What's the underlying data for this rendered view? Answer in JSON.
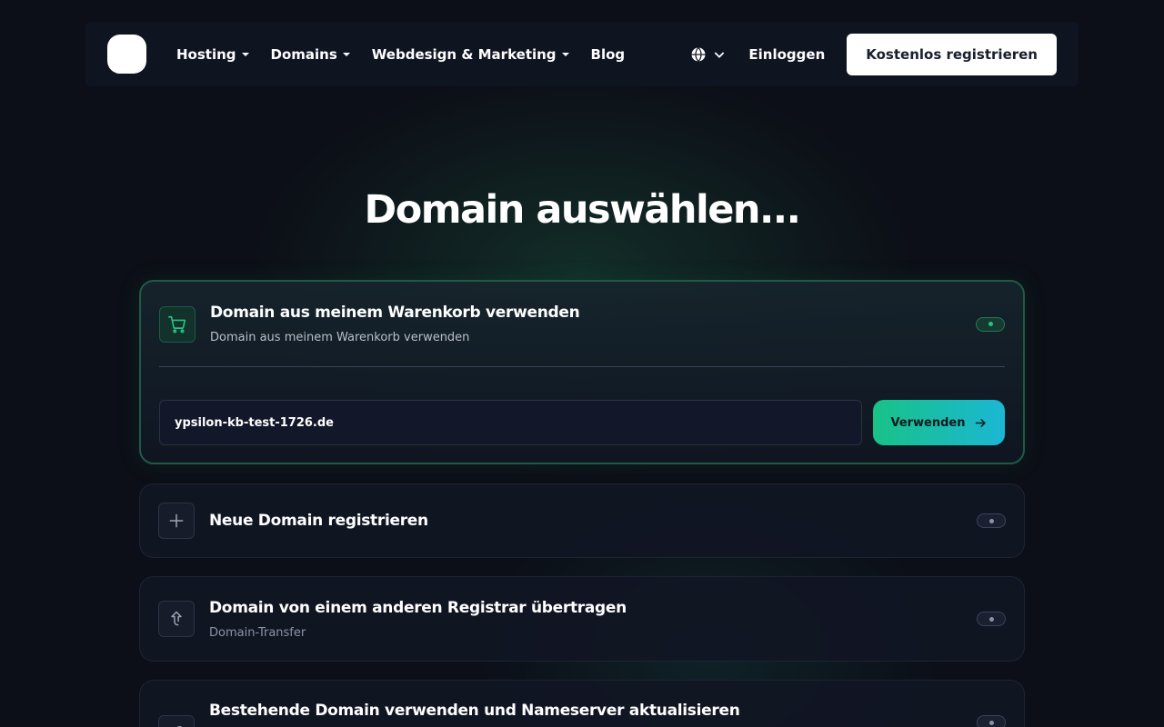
{
  "nav": {
    "items": [
      {
        "label": "Hosting",
        "dropdown": true
      },
      {
        "label": "Domains",
        "dropdown": true
      },
      {
        "label": "Webdesign & Marketing",
        "dropdown": true
      },
      {
        "label": "Blog",
        "dropdown": false
      }
    ],
    "language_icon": "globe-icon",
    "login_label": "Einloggen",
    "register_label": "Kostenlos registrieren"
  },
  "page": {
    "title": "Domain auswählen..."
  },
  "options": [
    {
      "title": "Domain aus meinem Warenkorb verwenden",
      "subtitle": "Domain aus meinem Warenkorb verwenden",
      "icon": "cart-icon",
      "selected": true,
      "input_value": "ypsilon-kb-test-1726.de",
      "button_label": "Verwenden"
    },
    {
      "title": "Neue Domain registrieren",
      "icon": "plus-icon",
      "selected": false
    },
    {
      "title": "Domain von einem anderen Registrar übertragen",
      "subtitle": "Domain-Transfer",
      "icon": "transfer-arrow-icon",
      "selected": false
    },
    {
      "title": "Bestehende Domain verwenden und Nameserver aktualisieren",
      "icon": "link-icon",
      "selected": false
    }
  ],
  "colors": {
    "background": "#0c0f17",
    "accent_green": "#18c287",
    "accent_cyan": "#1bb7d4",
    "active_border": "#1f5a44"
  }
}
